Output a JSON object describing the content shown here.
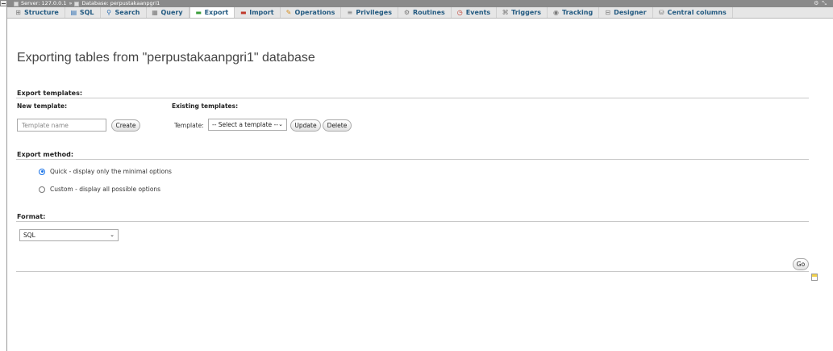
{
  "breadcrumb": {
    "server_label": "Server: 127.0.0.1",
    "separator": "»",
    "database_label": "Database: perpustakaanpgri1"
  },
  "tabs": [
    {
      "label": "Structure",
      "icon": "structure-icon"
    },
    {
      "label": "SQL",
      "icon": "sql-icon"
    },
    {
      "label": "Search",
      "icon": "search-icon"
    },
    {
      "label": "Query",
      "icon": "query-icon"
    },
    {
      "label": "Export",
      "icon": "export-icon",
      "active": true
    },
    {
      "label": "Import",
      "icon": "import-icon"
    },
    {
      "label": "Operations",
      "icon": "operations-icon"
    },
    {
      "label": "Privileges",
      "icon": "privileges-icon"
    },
    {
      "label": "Routines",
      "icon": "routines-icon"
    },
    {
      "label": "Events",
      "icon": "events-icon"
    },
    {
      "label": "Triggers",
      "icon": "triggers-icon"
    },
    {
      "label": "Tracking",
      "icon": "tracking-icon"
    },
    {
      "label": "Designer",
      "icon": "designer-icon"
    },
    {
      "label": "Central columns",
      "icon": "central-columns-icon"
    }
  ],
  "page_title": "Exporting tables from \"perpustakaanpgri1\" database",
  "export_templates": {
    "heading": "Export templates:",
    "new_template_label": "New template:",
    "template_name_placeholder": "Template name",
    "create_label": "Create",
    "existing_templates_label": "Existing templates:",
    "template_label": "Template:",
    "template_select_value": "-- Select a template --",
    "update_label": "Update",
    "delete_label": "Delete"
  },
  "export_method": {
    "heading": "Export method:",
    "quick_label": "Quick - display only the minimal options",
    "custom_label": "Custom - display all possible options",
    "selected": "quick"
  },
  "format": {
    "heading": "Format:",
    "selected_value": "SQL"
  },
  "go_label": "Go",
  "colors": {
    "tab_text": "#235a81",
    "server_bar": "#8a8a8a",
    "tab_bar": "#e6e6e6",
    "radio_checked": "#1a73e8"
  }
}
